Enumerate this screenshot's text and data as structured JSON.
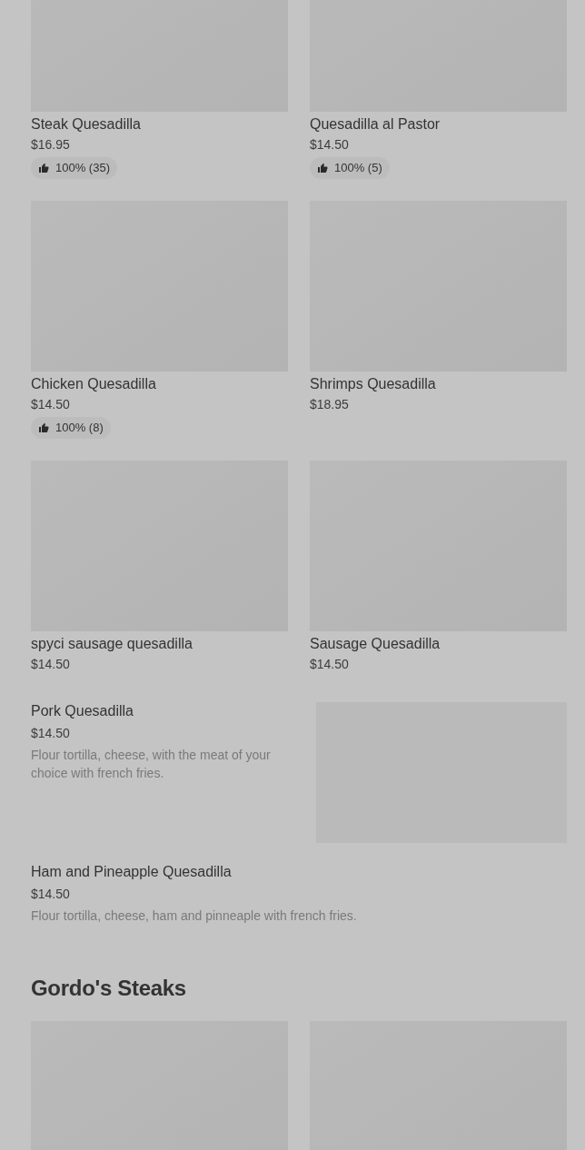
{
  "sections": [
    {
      "items": [
        {
          "kind": "card",
          "name": "Steak Quesadilla",
          "price": "$16.95",
          "rating": "100% (35)"
        },
        {
          "kind": "card",
          "name": "Quesadilla al Pastor",
          "price": "$14.50",
          "rating": "100% (5)"
        },
        {
          "kind": "card",
          "name": "Chicken Quesadilla",
          "price": "$14.50",
          "rating": "100% (8)"
        },
        {
          "kind": "card",
          "name": "Shrimps Quesadilla",
          "price": "$18.95"
        },
        {
          "kind": "card",
          "name": "spyci sausage quesadilla",
          "price": "$14.50"
        },
        {
          "kind": "card",
          "name": "Sausage Quesadilla",
          "price": "$14.50"
        },
        {
          "kind": "row",
          "name": "Pork Quesadilla",
          "price": "$14.50",
          "description": "Flour tortilla, cheese, with the meat of your choice with french fries.",
          "image": true
        },
        {
          "kind": "row",
          "name": "Ham and Pineapple Quesadilla",
          "price": "$14.50",
          "description": "Flour tortilla, cheese, ham and pinneaple with french fries."
        }
      ]
    },
    {
      "title": "Gordo's Steaks",
      "items": [
        {
          "kind": "card"
        },
        {
          "kind": "card"
        }
      ]
    }
  ]
}
